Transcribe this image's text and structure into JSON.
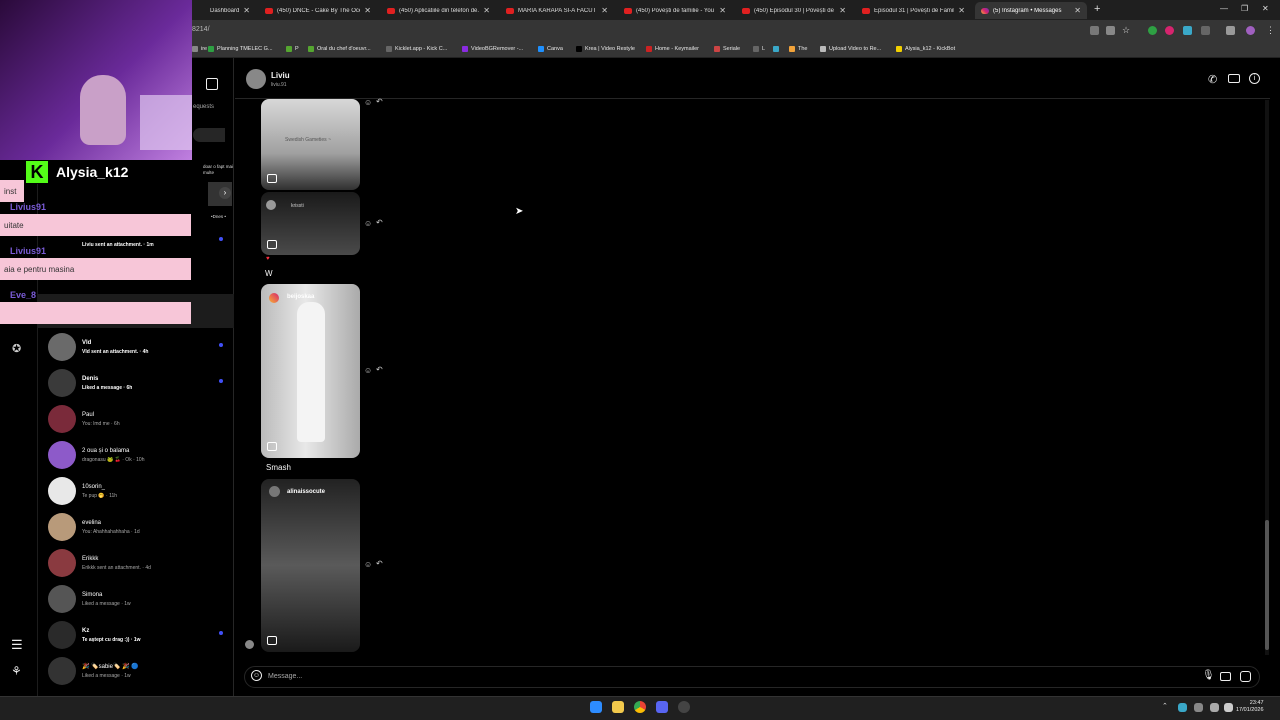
{
  "browser": {
    "tabs": [
      {
        "label": "Dashboard",
        "icon": "kick-icon"
      },
      {
        "label": "(450) DNCE - Cake By The Ocean",
        "icon": "youtube-icon"
      },
      {
        "label": "(450) Aplicatiile din telefon de...",
        "icon": "youtube-icon"
      },
      {
        "label": "MARIA KARAPA SI-A FACUT SO...",
        "icon": "youtube-icon"
      },
      {
        "label": "(450) Povești de familie - YouTu...",
        "icon": "youtube-icon"
      },
      {
        "label": "(450) Episodul 30 | Povești de F...",
        "icon": "youtube-icon"
      },
      {
        "label": "Episodul 31 | Povești de Familie",
        "icon": "youtube-icon"
      },
      {
        "label": "(5) Instagram • Messages",
        "icon": "instagram-icon",
        "active": true
      }
    ],
    "url": "8214/",
    "bookmarks": [
      "ire",
      "Planning TMELEC G...",
      "P",
      "Oral du chef d'oeuvr...",
      "Kicklet.app - Kick C...",
      "VideoBGRemover -...",
      "Canva",
      "Krea | Video Restyle",
      "Home - Keymailer",
      "Seriale",
      "L",
      "",
      "The",
      "Upload Video to Re...",
      "Alysia_k12 - KickBot"
    ]
  },
  "inbox": {
    "requests_label": "equests",
    "partial_preview": "Liviu sent an attachment. · 1m",
    "conversations": [
      {
        "name": "Vld",
        "preview": "Vld sent an attachment. · 4h",
        "unread": true,
        "color": "#6a6a6a"
      },
      {
        "name": "Denis",
        "preview": "Liked a message · 6h",
        "unread": true,
        "color": "#3a3a3a"
      },
      {
        "name": "Paul",
        "preview": "You: lmd me · 6h",
        "unread": false,
        "color": "#7a2a3a"
      },
      {
        "name": "2 oua și o balama",
        "preview": "dragonasu 🐸 🍒 · Ok · 10h",
        "unread": false,
        "color": "#8d5ac9"
      },
      {
        "name": "10sorin_",
        "preview": "Te pup 🤭 · 11h",
        "unread": false,
        "color": "#e8e8e8"
      },
      {
        "name": "evelina",
        "preview": "You: Ahahhahahhaha · 1d",
        "unread": false,
        "color": "#b89a7a"
      },
      {
        "name": "Erikkk",
        "preview": "Erikkk sent an attachment. · 4d",
        "unread": false,
        "color": "#8a3a40"
      },
      {
        "name": "Simona",
        "preview": "Liked a message · 1w",
        "unread": false,
        "color": "#555"
      },
      {
        "name": "Kz",
        "preview": "Te aștept cu drag :)) · 1w",
        "unread": true,
        "color": "#2a2a2a"
      },
      {
        "name": "🎉 🏷️sabie🏷️ 🎉 🔵",
        "preview": "Liked a message · 1w",
        "unread": false,
        "color": "#333"
      }
    ]
  },
  "chat": {
    "contact_name": "Liviu",
    "contact_handle": "liviu.91",
    "messages": [
      {
        "type": "reel",
        "caption": "Swedish Gameties ~"
      },
      {
        "type": "reel",
        "caption": "krissti"
      },
      {
        "type": "text",
        "text": "W"
      },
      {
        "type": "reel",
        "author": "beijoskaa"
      },
      {
        "type": "text",
        "text": "Smash"
      },
      {
        "type": "reel",
        "author": "alinaissocute"
      }
    ],
    "input_placeholder": "Message..."
  },
  "stream_overlay": {
    "streamer": "Alysia_k12",
    "chat": [
      {
        "user": "",
        "text": "inst"
      },
      {
        "user": "Livius91",
        "text": "uitate"
      },
      {
        "user": "Livius91",
        "text": "aia e pentru masina"
      },
      {
        "user": "Eve_8",
        "text": ""
      }
    ],
    "partial_texts": [
      "doar o fapt mai multe",
      "•Dnes •"
    ]
  },
  "taskbar": {
    "time": "23:47",
    "date": "17/01/2026"
  }
}
